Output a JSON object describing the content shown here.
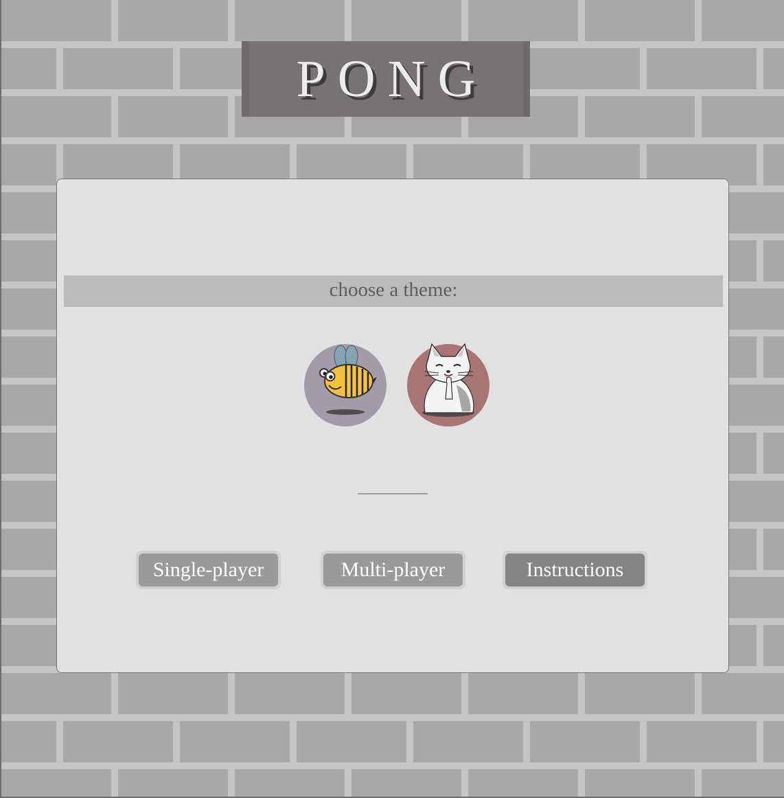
{
  "header": {
    "title": "PONG"
  },
  "panel": {
    "theme_prompt": "choose a theme:",
    "themes": [
      {
        "icon": "bee-icon",
        "color": "#a39ba9"
      },
      {
        "icon": "cat-icon",
        "color": "#a97474"
      }
    ]
  },
  "buttons": {
    "single_player": "Single-player",
    "multi_player": "Multi-player",
    "instructions": "Instructions"
  },
  "colors": {
    "brick": "#a8a8a8",
    "mortar": "#c4c4c4",
    "title_bg": "#767275",
    "panel_bg": "#e1e1e1"
  }
}
